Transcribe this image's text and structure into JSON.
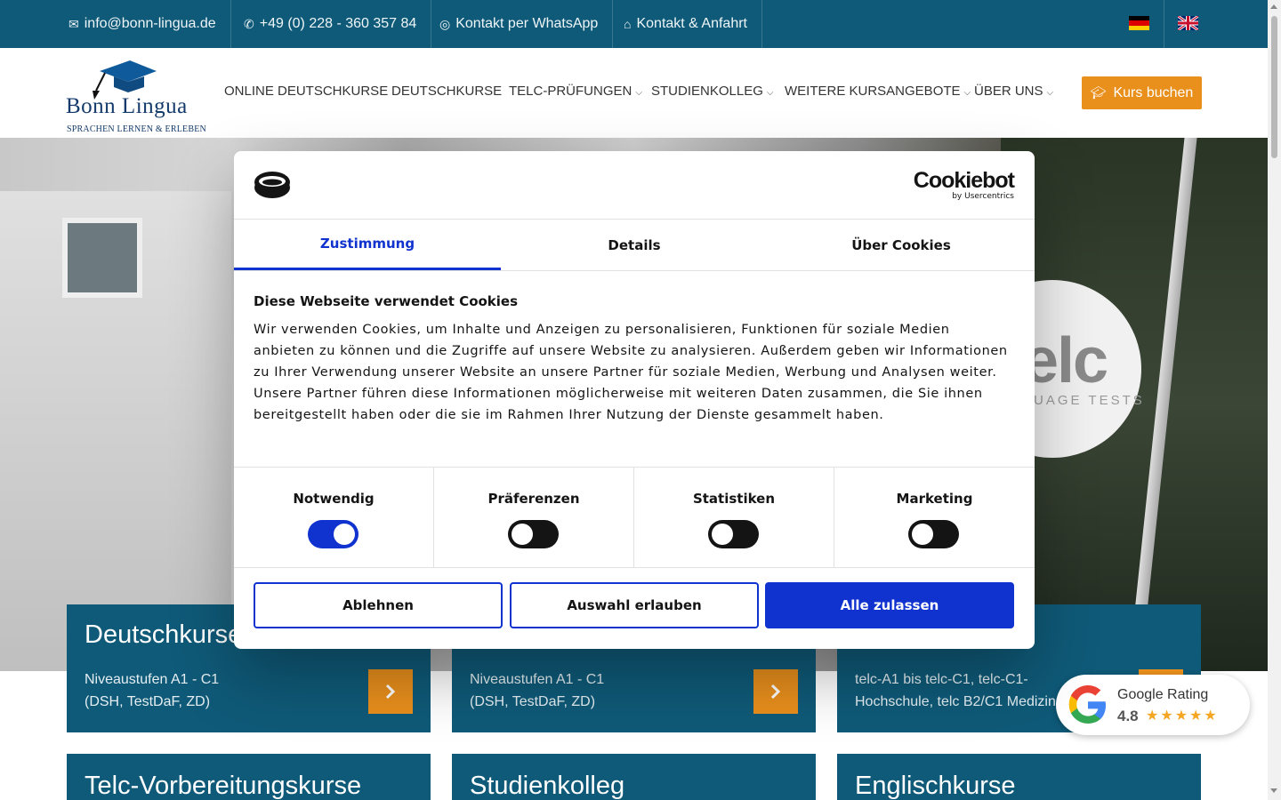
{
  "topbar": {
    "email": "info@bonn-lingua.de",
    "phone": "+49 (0) 228 - 360 357 84",
    "whatsapp": "Kontakt per WhatsApp",
    "contact": "Kontakt & Anfahrt"
  },
  "logo": {
    "name": "Bonn Lingua",
    "tagline": "Sprachen lernen & erleben"
  },
  "nav": {
    "items": [
      {
        "label": "ONLINE DEUTSCHKURSE"
      },
      {
        "label": "DEUTSCHKURSE"
      },
      {
        "label": "TELC-PRÜFUNGEN"
      },
      {
        "label": "STUDIENKOLLEG"
      },
      {
        "label": "WEITERE KURSANGEBOTE"
      },
      {
        "label": "ÜBER UNS"
      }
    ],
    "book_button": "Kurs buchen"
  },
  "hero": {
    "telc_word": "elc",
    "telc_sub": "UAGE TESTS"
  },
  "cards": [
    {
      "title": "Deutschkurse",
      "line1": "Niveaustufen A1 - C1",
      "line2": "(DSH, TestDaF, ZD)"
    },
    {
      "title": "",
      "line1": "Niveaustufen A1 - C1",
      "line2": "(DSH, TestDaF, ZD)"
    },
    {
      "title": "",
      "line1": "telc-A1 bis telc-C1, telc-C1-",
      "line2": "Hochschule, telc B2/C1 Medizin"
    },
    {
      "title": "Telc-Vorbereitungskurse"
    },
    {
      "title": "Studienkolleg"
    },
    {
      "title": "Englischkurse"
    }
  ],
  "google_rating": {
    "label": "Google Rating",
    "score": "4.8",
    "stars": "★★★★★"
  },
  "cookie": {
    "brand": "Cookiebot",
    "brand_sub": "by Usercentrics",
    "tabs": [
      {
        "label": "Zustimmung",
        "active": true
      },
      {
        "label": "Details",
        "active": false
      },
      {
        "label": "Über Cookies",
        "active": false
      }
    ],
    "title": "Diese Webseite verwendet Cookies",
    "body": "Wir verwenden Cookies, um Inhalte und Anzeigen zu personalisieren, Funktionen für soziale Medien anbieten zu können und die Zugriffe auf unsere Website zu analysieren. Außerdem geben wir Informationen zu Ihrer Verwendung unserer Website an unsere Partner für soziale Medien, Werbung und Analysen weiter. Unsere Partner führen diese Informationen möglicherweise mit weiteren Daten zusammen, die Sie ihnen bereitgestellt haben oder die sie im Rahmen Ihrer Nutzung der Dienste gesammelt haben.",
    "toggles": [
      {
        "label": "Notwendig",
        "on": true
      },
      {
        "label": "Präferenzen",
        "on": false
      },
      {
        "label": "Statistiken",
        "on": false
      },
      {
        "label": "Marketing",
        "on": false
      }
    ],
    "buttons": {
      "decline": "Ablehnen",
      "allow_selection": "Auswahl erlauben",
      "allow_all": "Alle zulassen"
    }
  },
  "colors": {
    "brand_blue": "#0f5a78",
    "accent_orange": "#e88f1c",
    "cookie_blue": "#1032cf"
  }
}
